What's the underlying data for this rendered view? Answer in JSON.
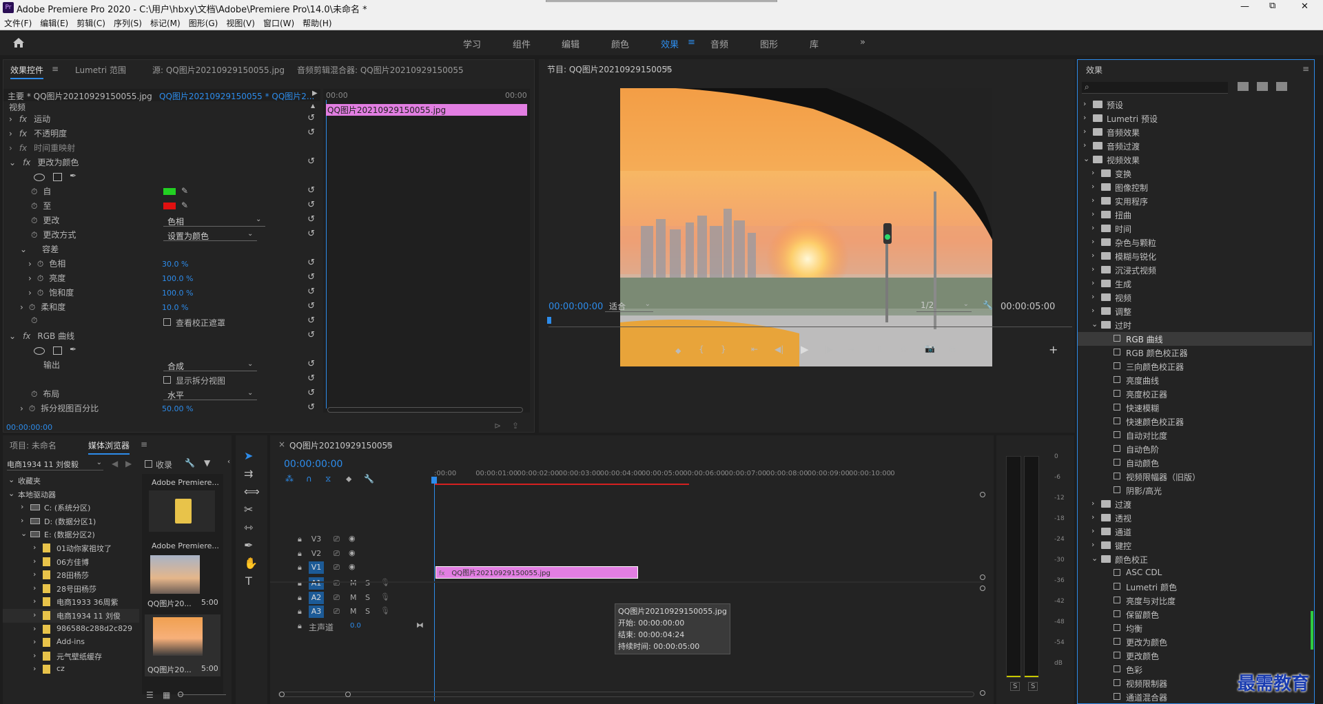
{
  "app": {
    "title": "Adobe Premiere Pro 2020 - C:\\用户\\hbxy\\文档\\Adobe\\Premiere Pro\\14.0\\未命名 *",
    "logo": "Pr",
    "win_min": "—",
    "win_max": "⧉",
    "win_close": "✕"
  },
  "menu": [
    "文件(F)",
    "编辑(E)",
    "剪辑(C)",
    "序列(S)",
    "标记(M)",
    "图形(G)",
    "视图(V)",
    "窗口(W)",
    "帮助(H)"
  ],
  "workspaces": {
    "home_icon": "home-icon",
    "items": [
      "学习",
      "组件",
      "编辑",
      "颜色",
      "效果",
      "音频",
      "图形",
      "库"
    ],
    "active": "效果",
    "more": "»"
  },
  "effect_controls": {
    "tabs": [
      "效果控件",
      "Lumetri 范围",
      "源: QQ图片20210929150055.jpg",
      "音频剪辑混合器: QQ图片20210929150055"
    ],
    "master": "主要 * QQ图片20210929150055.jpg",
    "sequence": "QQ图片20210929150055 * QQ图片2...",
    "time_start": "00:00",
    "time_end": "00:00",
    "clip_name": "QQ图片20210929150055.jpg",
    "section": "视频",
    "rows": [
      {
        "label": "运动"
      },
      {
        "label": "不透明度"
      },
      {
        "label": "时间重映射"
      },
      {
        "label": "更改为颜色"
      },
      {
        "label": "自"
      },
      {
        "label": "至"
      },
      {
        "label": "更改",
        "value": "色相"
      },
      {
        "label": "更改方式",
        "value": "设置为颜色"
      },
      {
        "label": "容差"
      },
      {
        "label": "色相",
        "value": "30.0 %"
      },
      {
        "label": "亮度",
        "value": "100.0 %"
      },
      {
        "label": "饱和度",
        "value": "100.0 %"
      },
      {
        "label": "柔和度",
        "value": "10.0 %"
      },
      {
        "label": "",
        "value": "查看校正遮罩"
      },
      {
        "label": "RGB 曲线"
      },
      {
        "label": "输出",
        "value": "合成"
      },
      {
        "label": "",
        "value": "显示拆分视图"
      },
      {
        "label": "布局",
        "value": "水平"
      },
      {
        "label": "拆分视图百分比",
        "value": "50.00 %"
      }
    ],
    "timecode": "00:00:00:00",
    "from_color": "#22d022",
    "to_color": "#e01010"
  },
  "program": {
    "title": "节目: QQ图片20210929150055",
    "timecode": "00:00:00:00",
    "fit": "适合",
    "res": "1/2",
    "duration": "00:00:05:00"
  },
  "effects": {
    "title": "效果",
    "items": [
      {
        "label": "预设",
        "lvl": 0,
        "open": false
      },
      {
        "label": "Lumetri 预设",
        "lvl": 0,
        "open": false
      },
      {
        "label": "音频效果",
        "lvl": 0,
        "open": false
      },
      {
        "label": "音频过渡",
        "lvl": 0,
        "open": false
      },
      {
        "label": "视频效果",
        "lvl": 0,
        "open": true
      },
      {
        "label": "变换",
        "lvl": 1
      },
      {
        "label": "图像控制",
        "lvl": 1
      },
      {
        "label": "实用程序",
        "lvl": 1
      },
      {
        "label": "扭曲",
        "lvl": 1
      },
      {
        "label": "时间",
        "lvl": 1
      },
      {
        "label": "杂色与颗粒",
        "lvl": 1
      },
      {
        "label": "模糊与锐化",
        "lvl": 1
      },
      {
        "label": "沉浸式视频",
        "lvl": 1
      },
      {
        "label": "生成",
        "lvl": 1
      },
      {
        "label": "视频",
        "lvl": 1
      },
      {
        "label": "调整",
        "lvl": 1
      },
      {
        "label": "过时",
        "lvl": 1,
        "open": true
      },
      {
        "label": "RGB 曲线",
        "lvl": 2,
        "sel": true
      },
      {
        "label": "RGB 颜色校正器",
        "lvl": 2
      },
      {
        "label": "三向颜色校正器",
        "lvl": 2
      },
      {
        "label": "亮度曲线",
        "lvl": 2
      },
      {
        "label": "亮度校正器",
        "lvl": 2
      },
      {
        "label": "快速模糊",
        "lvl": 2
      },
      {
        "label": "快速颜色校正器",
        "lvl": 2
      },
      {
        "label": "自动对比度",
        "lvl": 2
      },
      {
        "label": "自动色阶",
        "lvl": 2
      },
      {
        "label": "自动颜色",
        "lvl": 2
      },
      {
        "label": "视频限幅器（旧版）",
        "lvl": 2
      },
      {
        "label": "阴影/高光",
        "lvl": 2
      },
      {
        "label": "过渡",
        "lvl": 1
      },
      {
        "label": "透视",
        "lvl": 1
      },
      {
        "label": "通道",
        "lvl": 1
      },
      {
        "label": "键控",
        "lvl": 1
      },
      {
        "label": "颜色校正",
        "lvl": 1,
        "open": true
      },
      {
        "label": "ASC CDL",
        "lvl": 2
      },
      {
        "label": "Lumetri 颜色",
        "lvl": 2
      },
      {
        "label": "亮度与对比度",
        "lvl": 2
      },
      {
        "label": "保留颜色",
        "lvl": 2
      },
      {
        "label": "均衡",
        "lvl": 2
      },
      {
        "label": "更改为颜色",
        "lvl": 2
      },
      {
        "label": "更改颜色",
        "lvl": 2
      },
      {
        "label": "色彩",
        "lvl": 2
      },
      {
        "label": "视频限制器",
        "lvl": 2
      },
      {
        "label": "通道混合器",
        "lvl": 2
      }
    ]
  },
  "project": {
    "tabs": [
      "项目: 未命名",
      "媒体浏览器"
    ],
    "location": "电商1934 11 刘俊毅",
    "ingest": "收录",
    "tree": [
      {
        "label": "收藏夹",
        "lvl": 0
      },
      {
        "label": "本地驱动器",
        "lvl": 0
      },
      {
        "label": "C: (系统分区)",
        "lvl": 1,
        "drive": true
      },
      {
        "label": "D: (数据分区1)",
        "lvl": 1,
        "drive": true
      },
      {
        "label": "E: (数据分区2)",
        "lvl": 1,
        "drive": true
      },
      {
        "label": "01动你家祖坟了",
        "lvl": 2
      },
      {
        "label": "06方佳博",
        "lvl": 2
      },
      {
        "label": "28田杨莎",
        "lvl": 2
      },
      {
        "label": "28号田杨莎",
        "lvl": 2
      },
      {
        "label": "电商1933 36周紫",
        "lvl": 2
      },
      {
        "label": "电商1934 11 刘俊",
        "lvl": 2,
        "sel": true
      },
      {
        "label": "986588c288d2c829",
        "lvl": 2
      },
      {
        "label": "Add-ins",
        "lvl": 2
      },
      {
        "label": "元气壁纸缓存",
        "lvl": 2
      },
      {
        "label": "cz",
        "lvl": 2
      }
    ],
    "thumbs": [
      {
        "label": "Adobe Premiere..."
      },
      {
        "label": "Adobe Premiere..."
      },
      {
        "label": "QQ图片20...",
        "dur": "5:00"
      },
      {
        "label": "QQ图片20...",
        "dur": "5:00"
      }
    ]
  },
  "timeline": {
    "tab": "QQ图片20210929150055",
    "timecode": "00:00:00:00",
    "ruler": [
      ":00:00",
      "00:00:01:00",
      "00:00:02:00",
      "00:00:03:00",
      "00:00:04:00",
      "00:00:05:00",
      "00:00:06:00",
      "00:00:07:00",
      "00:00:08:00",
      "00:00:09:00",
      "00:00:10:00",
      "0"
    ],
    "video_tracks": [
      "V3",
      "V2",
      "V1"
    ],
    "audio_tracks": [
      "A1",
      "A2",
      "A3"
    ],
    "master": "主声道",
    "master_val": "0.0",
    "clip": "QQ图片20210929150055.jpg",
    "tooltip": [
      "QQ图片20210929150055.jpg",
      "开始: 00:00:00:00",
      "结束: 00:00:04:24",
      "持续时间: 00:00:05:00"
    ],
    "m": "M",
    "s": "S"
  },
  "meter": {
    "db": [
      "0",
      "-6",
      "-12",
      "-18",
      "-24",
      "-30",
      "-36",
      "-42",
      "-48",
      "-54",
      "dB"
    ],
    "solo": "S"
  },
  "watermark": "最需教育"
}
